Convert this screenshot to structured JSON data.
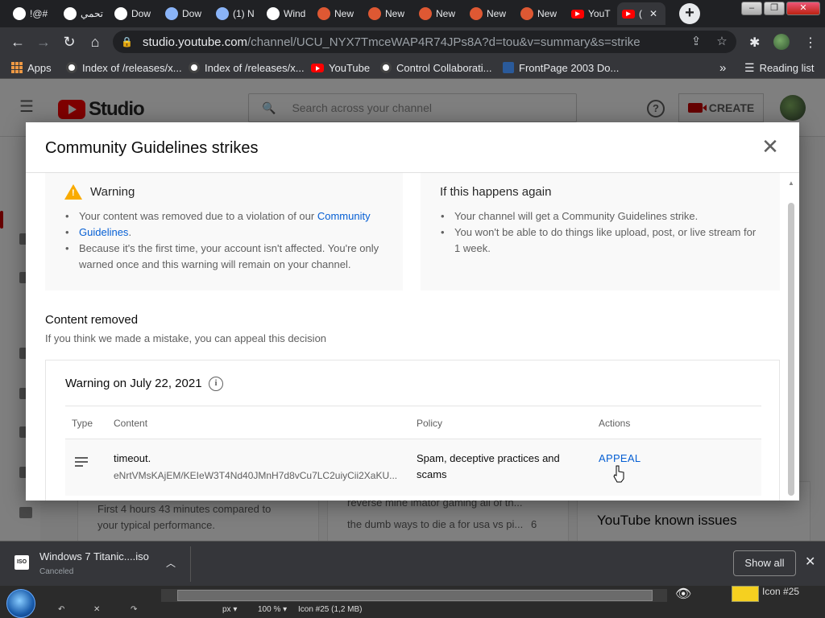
{
  "browser": {
    "tabs": [
      {
        "label": "!@#",
        "icon": "globe",
        "color": "#ffffff"
      },
      {
        "label": "تحمي",
        "icon": "app",
        "color": "#ffffff"
      },
      {
        "label": "Dow",
        "icon": "app",
        "color": "#ffffff"
      },
      {
        "label": "Dow",
        "icon": "drive",
        "color": "#8ab4f8"
      },
      {
        "label": "(1) N",
        "icon": "drive",
        "color": "#8ab4f8"
      },
      {
        "label": "Wind",
        "icon": "bank",
        "color": "#ffffff"
      },
      {
        "label": "New",
        "icon": "duck",
        "color": "#de5833"
      },
      {
        "label": "New",
        "icon": "duck",
        "color": "#de5833"
      },
      {
        "label": "New",
        "icon": "duck",
        "color": "#de5833"
      },
      {
        "label": "New",
        "icon": "duck",
        "color": "#de5833"
      },
      {
        "label": "New",
        "icon": "duck",
        "color": "#de5833"
      },
      {
        "label": "YouT",
        "icon": "youtube",
        "color": "#ff0000"
      },
      {
        "label": "(",
        "icon": "youtube",
        "color": "#ff0000",
        "active": true
      }
    ],
    "new_tab": "+",
    "url_host": "studio.youtube.com",
    "url_path": "/channel/UCU_NYX7TmceWAP4R74JPs8A?d=tou&v=summary&s=strike",
    "bookmarks": [
      {
        "label": "Apps",
        "icon": "apps-grid"
      },
      {
        "label": "Index of /releases/x...",
        "icon": "globe"
      },
      {
        "label": "Index of /releases/x...",
        "icon": "globe"
      },
      {
        "label": "YouTube",
        "icon": "youtube"
      },
      {
        "label": "Control Collaborati...",
        "icon": "globe"
      },
      {
        "label": "FrontPage 2003 Do...",
        "icon": "frontpage"
      }
    ],
    "bookmarks_overflow": "»",
    "reading_list": "Reading list"
  },
  "studio": {
    "logo_text": "Studio",
    "search_placeholder": "Search across your channel",
    "create_label": "CREATE",
    "bg_texts": [
      "First 4 hours 43 minutes compared to",
      "your typical performance.",
      "reverse mine imator gaming all of th...",
      "the dumb ways to die a for usa vs pi...",
      "6",
      "YouTube known issues"
    ]
  },
  "modal": {
    "title": "Community Guidelines strikes",
    "warning": {
      "title": "Warning",
      "bullet1_prefix": "Your content was removed due to a violation of our ",
      "bullet1_link_a": "Community",
      "bullet1_link_b": "Guidelines",
      "bullet1_suffix": ".",
      "bullet2_line1": "Because it's the first time, your account isn't affected. You're only",
      "bullet2_line2": "warned once and this warning will remain on your channel."
    },
    "again": {
      "title": "If this happens again",
      "bullet1": "Your channel will get a Community Guidelines strike.",
      "bullet2_line1": "You won't be able to do things like upload, post, or live stream for",
      "bullet2_line2": "1 week."
    },
    "content_removed": {
      "title": "Content removed",
      "subtitle": "If you think we made a mistake, you can appeal this decision"
    },
    "strike": {
      "heading": "Warning on July 22, 2021",
      "columns": [
        "Type",
        "Content",
        "Policy",
        "Actions"
      ],
      "row": {
        "content_title": "timeout.",
        "content_id": "eNrtVMsKAjEM/KEIeW3T4Nd40JMnH7d8vCu7LC2uiyCii2XaKU...",
        "policy_line1": "Spam, deceptive practices and",
        "policy_line2": "scams",
        "action": "APPEAL"
      }
    }
  },
  "downloads": {
    "file_name": "Windows 7 Titanic....iso",
    "status": "Canceled",
    "icon_text": "ISO",
    "show_all": "Show all"
  },
  "taskbar": {
    "unit": "px",
    "zoom": "100 %",
    "layer_info": "Icon #25 (1,2 MB)",
    "thumb_label": "Icon #25"
  }
}
